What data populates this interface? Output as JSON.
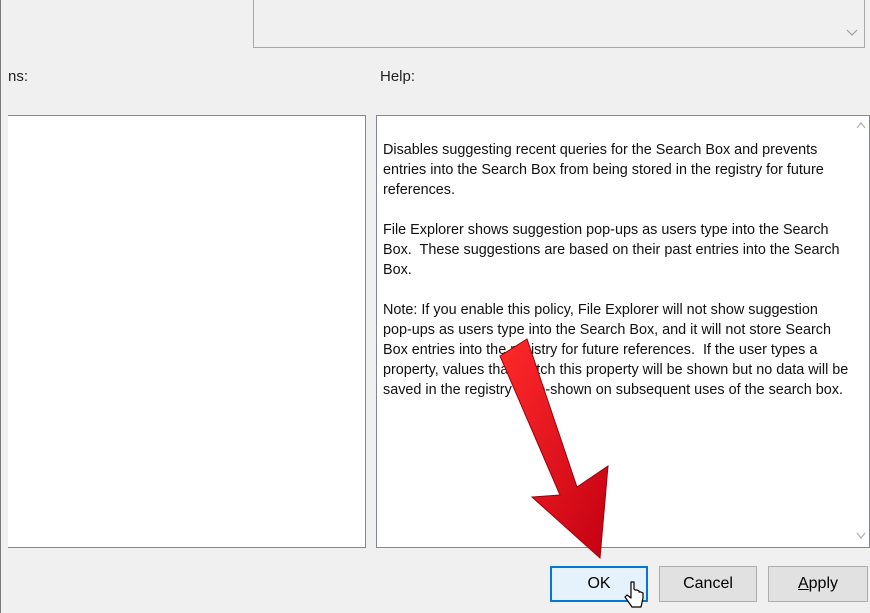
{
  "window": {
    "options_label": "ns:",
    "help_label": "Help:"
  },
  "help": {
    "paragraphs": [
      "Disables suggesting recent queries for the Search Box and prevents entries into the Search Box from being stored in the registry for future references.",
      "File Explorer shows suggestion pop-ups as users type into the Search Box.  These suggestions are based on their past entries into the Search Box.",
      "Note: If you enable this policy, File Explorer will not show suggestion pop-ups as users type into the Search Box, and it will not store Search Box entries into the registry for future references.  If the user types a property, values that match this property will be shown but no data will be saved in the registry or re-shown on subsequent uses of the search box."
    ]
  },
  "buttons": {
    "ok": "OK",
    "cancel": "Cancel",
    "apply_prefix": "",
    "apply_underlined": "A",
    "apply_rest": "pply"
  },
  "icons": {
    "dropdown": "chevron-down-icon",
    "scroll_up": "scroll-up-icon",
    "scroll_down": "scroll-down-icon",
    "pointer": "mouse-pointer-icon",
    "annotation": "red-arrow-icon"
  },
  "colors": {
    "ok_border": "#0078d7",
    "annotation_arrow": "#e8001c"
  }
}
